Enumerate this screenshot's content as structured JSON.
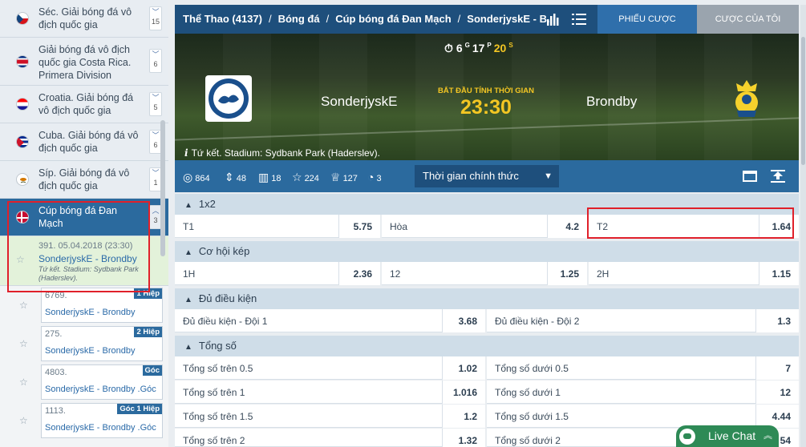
{
  "sidebar": {
    "leagues": [
      {
        "name": "Séc. Giải bóng đá vô địch quốc gia",
        "count": "15",
        "flag": "czech"
      },
      {
        "name": "Giải bóng đá vô địch quốc gia Costa Rica. Primera Division",
        "count": "6",
        "flag": "costa-rica"
      },
      {
        "name": "Croatia. Giải bóng đá vô địch quốc gia",
        "count": "5",
        "flag": "croatia"
      },
      {
        "name": "Cuba. Giải bóng đá vô địch quốc gia",
        "count": "6",
        "flag": "cuba"
      },
      {
        "name": "Síp. Giải bóng đá vô địch quốc gia",
        "count": "1",
        "flag": "cyprus"
      },
      {
        "name": "Cúp bóng đá Đan Mạch",
        "count": "3",
        "flag": "denmark"
      }
    ],
    "active_match": {
      "line1": "391. 05.04.2018 (23:30)",
      "teams": "SonderjyskE - Brondby",
      "venue": "Tứ kết. Stadium: Sydbank Park (Haderslev)."
    },
    "sub_matches": [
      {
        "id": "6769.",
        "teams": "SonderjyskE - Brondby",
        "badge": "1 Hiệp"
      },
      {
        "id": "275.",
        "teams": "SonderjyskE - Brondby",
        "badge": "2 Hiệp"
      },
      {
        "id": "4803.",
        "teams": "SonderjyskE - Brondby .Góc",
        "badge": "Góc"
      },
      {
        "id": "1113.",
        "teams": "SonderjyskE - Brondby .Góc",
        "badge": "Góc 1 Hiệp"
      }
    ]
  },
  "header": {
    "breadcrumb": [
      "Thể Thao (4137)",
      "Bóng đá",
      "Cúp bóng đá Đan Mạch",
      "SonderjyskE - B..."
    ],
    "btn_slip": "PHIẾU CƯỢC",
    "btn_my": "CƯỢC CỦA TÔI"
  },
  "match": {
    "timer": {
      "days": "6",
      "hours": "17",
      "minutes": "20",
      "u_days": "G",
      "u_hours": "P",
      "u_minutes": "S"
    },
    "home": "SonderjyskE",
    "away": "Brondby",
    "start_label": "BẮT ĐẦU TÍNH THỜI GIAN",
    "start_time": "23:30",
    "venue": "Tứ kết. Stadium: Sydbank Park (Haderslev)."
  },
  "stats": {
    "s1": "864",
    "s2": "48",
    "s3": "18",
    "s4": "224",
    "s5": "127",
    "s6": "3",
    "period": "Thời gian chính thức"
  },
  "markets": {
    "m1": {
      "title": "1x2",
      "c1": {
        "label": "T1",
        "value": "5.75"
      },
      "c2": {
        "label": "Hòa",
        "value": "4.2"
      },
      "c3": {
        "label": "T2",
        "value": "1.64"
      }
    },
    "m2": {
      "title": "Cơ hội kép",
      "c1": {
        "label": "1H",
        "value": "2.36"
      },
      "c2": {
        "label": "12",
        "value": "1.25"
      },
      "c3": {
        "label": "2H",
        "value": "1.15"
      }
    },
    "m3": {
      "title": "Đủ điều kiện",
      "c1": {
        "label": "Đủ điều kiện - Đội 1",
        "value": "3.68"
      },
      "c2": {
        "label": "Đủ điều kiện - Đội 2",
        "value": "1.3"
      }
    },
    "m4": {
      "title": "Tổng số",
      "rows": [
        {
          "over_label": "Tổng số trên 0.5",
          "over_value": "1.02",
          "under_label": "Tổng số dưới 0.5",
          "under_value": "7"
        },
        {
          "over_label": "Tổng số trên 1",
          "over_value": "1.016",
          "under_label": "Tổng số dưới 1",
          "under_value": "12"
        },
        {
          "over_label": "Tổng số trên 1.5",
          "over_value": "1.2",
          "under_label": "Tổng số dưới 1.5",
          "under_value": "4.44"
        },
        {
          "over_label": "Tổng số trên 2",
          "over_value": "1.32",
          "under_label": "Tổng số dưới 2",
          "under_value": "54"
        }
      ]
    }
  },
  "livechat": "Live Chat",
  "colors": {
    "accent": "#2b6a9e",
    "header": "#1e4f7c",
    "highlight": "#e0202a",
    "gold": "#f3c623",
    "chat": "#2e8a56"
  }
}
